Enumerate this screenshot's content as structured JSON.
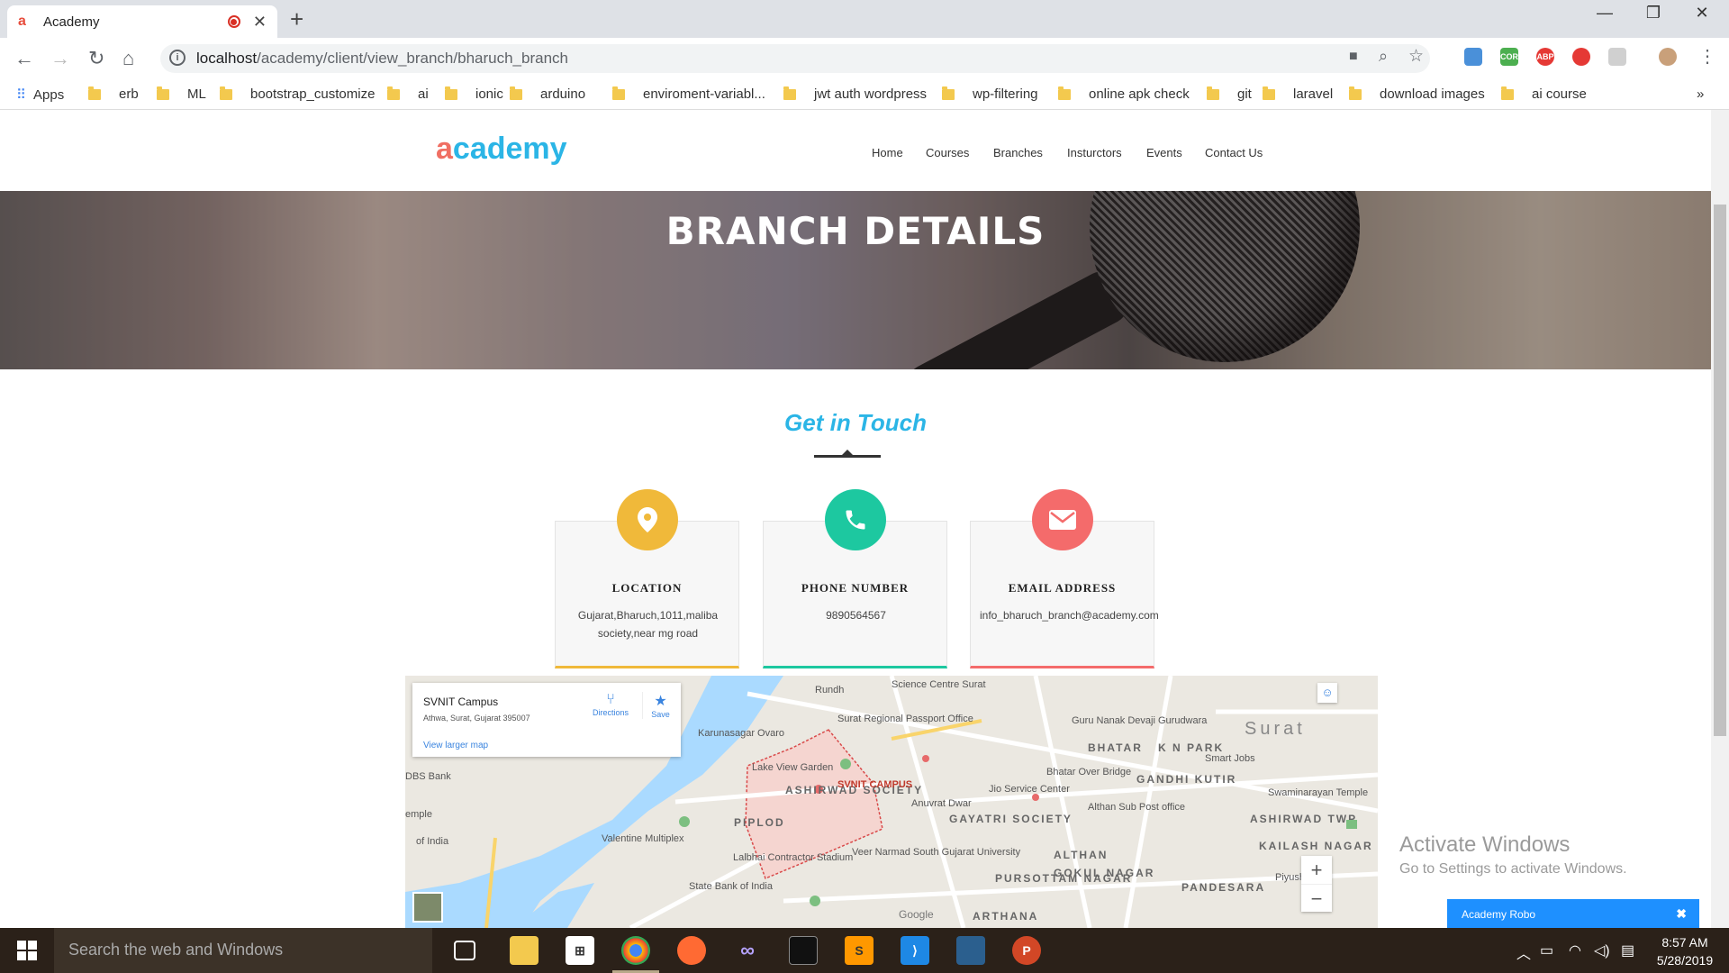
{
  "browser": {
    "tab_title": "Academy",
    "url_host": "localhost",
    "url_path": "/academy/client/view_branch/bharuch_branch",
    "bookmarks": [
      "Apps",
      "erb",
      "ML",
      "bootstrap_customize",
      "ai",
      "ionic",
      "arduino",
      "enviroment-variabl...",
      "jwt auth wordpress",
      "wp-filtering",
      "online apk check",
      "git",
      "laravel",
      "download images",
      "ai course"
    ],
    "extensions": [
      {
        "label": "",
        "color": "#4a90d9"
      },
      {
        "label": "CORS",
        "color": "#4caf50"
      },
      {
        "label": "ABP",
        "color": "#e53935"
      },
      {
        "label": "",
        "color": "#e53935"
      },
      {
        "label": "",
        "color": "#d0d0d0"
      }
    ]
  },
  "site": {
    "logo": "academy",
    "menu": [
      "Home",
      "Courses",
      "Branches",
      "Insturctors",
      "Events",
      "Contact Us"
    ],
    "hero_title": "BRANCH DETAILS",
    "section_title": "Get in Touch",
    "cards": [
      {
        "title": "LOCATION",
        "value": "Gujarat,Bharuch,1011,maliba society,near mg road",
        "icon": "location-pin-icon",
        "color": "#f0b93a"
      },
      {
        "title": "PHONE NUMBER",
        "value": "9890564567",
        "icon": "phone-icon",
        "color": "#1dc8a0"
      },
      {
        "title": "EMAIL ADDRESS",
        "value": "info_bharuch_branch@academy.com",
        "icon": "envelope-icon",
        "color": "#f46b6b"
      }
    ]
  },
  "map": {
    "place_name": "SVNIT Campus",
    "place_address": "Athwa, Surat, Gujarat 395007",
    "directions_label": "Directions",
    "save_label": "Save",
    "larger_map_link": "View larger map",
    "labels": [
      "Rundh",
      "Science Centre Surat",
      "Surat Regional Passport Office",
      "Karunasagar Ovaro",
      "Lake View Garden",
      "ASHIRWAD SOCIETY",
      "SVNIT CAMPUS",
      "Anuvrat Dwar",
      "PIPLOD",
      "GAYATRI SOCIETY",
      "Valentine Multiplex",
      "Veer Narmad South Gujarat University",
      "Lalbhai Contractor Stadium",
      "State Bank of India",
      "ALTHAN",
      "GOKUL NAGAR",
      "PURSOTTAM NAGAR",
      "BHATAR",
      "K N PARK",
      "Surat",
      "Smart Jobs",
      "Guru Nanak Devaji Gurudwara",
      "Jio Service Center",
      "Bhatar Over Bridge",
      "GANDHI KUTIR",
      "Swaminarayan Temple",
      "Althan Sub Post office",
      "ASHIRWAD TWP",
      "KAILASH NAGAR",
      "PANDESARA",
      "Piyush F",
      "DBS Bank",
      "emple",
      "of India",
      "Google",
      "ARTHANA"
    ],
    "zoom_in": "+",
    "zoom_out": "−"
  },
  "watermark": {
    "line1": "Activate Windows",
    "line2": "Go to Settings to activate Windows."
  },
  "chat": {
    "title": "Academy Robo",
    "close": "✖"
  },
  "taskbar": {
    "search_placeholder": "Search the web and Windows",
    "time": "8:57 AM",
    "date": "5/28/2019"
  }
}
